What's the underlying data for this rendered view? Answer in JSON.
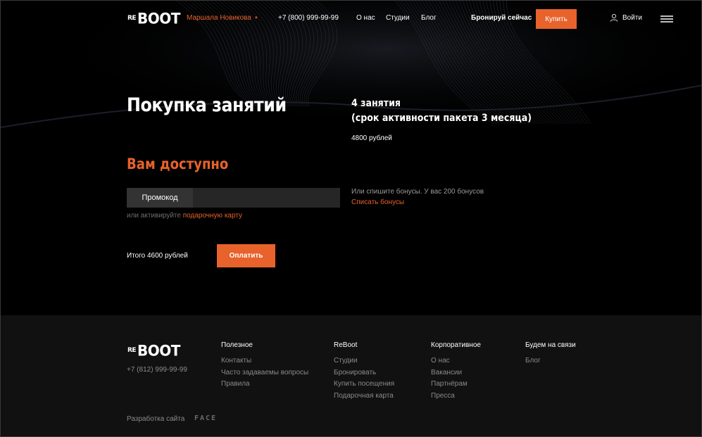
{
  "header": {
    "logo_re": "RE",
    "logo_boot": "BOOT",
    "user_name": "Маршала Новикова",
    "phone": "+7 (800) 999-99-99",
    "nav": [
      "О нас",
      "Студии",
      "Блог"
    ],
    "book_now": "Бронируй сейчас",
    "buy_label": "Купить",
    "login_label": "Войти"
  },
  "main": {
    "title": "Покупка занятий",
    "package_line1": "4 занятия",
    "package_line2": "(срок активности пакета 3 месяца)",
    "package_price": "4800 рублей",
    "available_title": "Вам доступно",
    "promo_label": "Промокод",
    "promo_value": "",
    "gift_prefix": "или активируйте ",
    "gift_link": "подарочную карту",
    "bonus_text": "Или спишите бонусы. У вас 200 бонусов",
    "bonus_link": "Списать бонусы",
    "total": "Итого 4600 рублей",
    "pay_label": "Оплатить"
  },
  "footer": {
    "phone": "+7 (812) 999-99-99",
    "columns": [
      {
        "title": "Полезное",
        "links": [
          "Контакты",
          "Часто задаваемы вопросы",
          "Правила"
        ]
      },
      {
        "title": "ReBoot",
        "links": [
          "Студии",
          "Бронировать",
          "Купить посещения",
          "Подарочная карта"
        ]
      },
      {
        "title": "Корпоративное",
        "links": [
          "О нас",
          "Вакансии",
          "Партнёрам",
          "Пресса"
        ]
      },
      {
        "title": "Будем на связи",
        "links": [
          "Блог"
        ]
      }
    ],
    "dev_label": "Разработка сайта",
    "dev_logo": "FACE"
  },
  "colors": {
    "accent": "#e8622b",
    "background": "#000000",
    "footer_background": "#111111",
    "muted_text": "#8a8a8a"
  },
  "icons": [
    "user-icon",
    "hamburger-menu-icon",
    "chevron-down-icon"
  ]
}
